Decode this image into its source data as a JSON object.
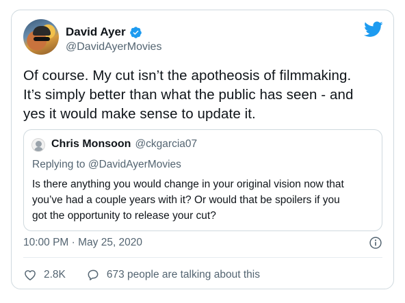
{
  "tweet": {
    "author_name": "David Ayer",
    "author_handle": "@DavidAyerMovies",
    "text": "Of course. My cut isn’t the apotheosis of filmmaking.\nIt’s simply better than what the public has seen - and\nyes it would make sense to update it.",
    "timestamp": "10:00 PM · May 25, 2020",
    "likes": "2.8K",
    "talking": "673 people are talking about this"
  },
  "quote": {
    "author_name": "Chris Monsoon",
    "author_handle": "@ckgarcia07",
    "replying_to": "Replying to @DavidAyerMovies",
    "text": "Is there anything you would change in your original vision now that\nyou’ve had a couple years with it? Or would that be spoilers if you\ngot the opportunity to release your cut?"
  },
  "icons": {
    "verified": "verified-badge-icon",
    "brand": "twitter-bird-icon",
    "info": "info-icon",
    "like": "heart-icon",
    "reply": "comment-bubble-icon"
  },
  "colors": {
    "brand_blue": "#1d9bf0",
    "text": "#0f1419",
    "secondary": "#536471",
    "border": "#cfd9de"
  }
}
